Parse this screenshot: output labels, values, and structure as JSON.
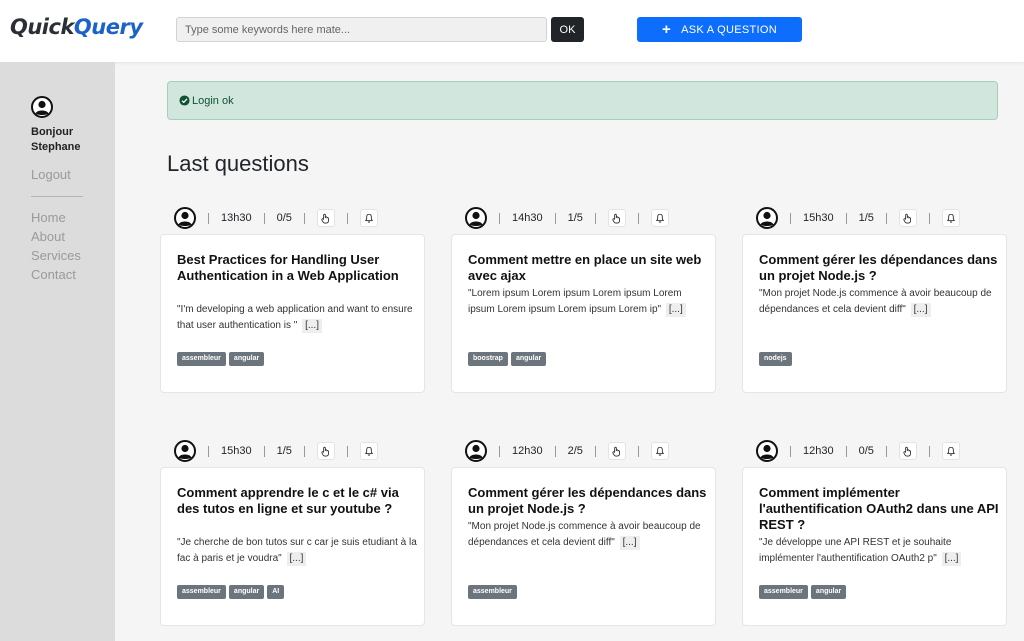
{
  "header": {
    "logo_part1": "Quick",
    "logo_part2": "Query",
    "search_placeholder": "Type some keywords here mate...",
    "ok_label": "OK",
    "ask_label": "ASK A QUESTION"
  },
  "sidebar": {
    "greeting_line1": "Bonjour",
    "greeting_line2": "Stephane",
    "logout": "Logout",
    "nav": [
      "Home",
      "About",
      "Services",
      "Contact"
    ]
  },
  "alert": {
    "text": "Login ok"
  },
  "section_title": "Last questions",
  "questions": [
    {
      "time": "13h30",
      "rating": "0/5",
      "title": "Best Practices for Handling User Authentication in a Web Application",
      "excerpt": "\"I'm developing a web application and want to ensure that user authentication is \"",
      "more": "[...]",
      "tags": [
        "assembleur",
        "angular"
      ]
    },
    {
      "time": "14h30",
      "rating": "1/5",
      "title": "Comment mettre en place un site web avec ajax",
      "excerpt": "\"Lorem ipsum Lorem ipsum Lorem ipsum Lorem ipsum Lorem ipsum Lorem ipsum Lorem ip\"",
      "more": "[...]",
      "tags": [
        "boostrap",
        "angular"
      ]
    },
    {
      "time": "15h30",
      "rating": "1/5",
      "title": "Comment gérer les dépendances dans un projet Node.js ?",
      "excerpt": "\"Mon projet Node.js commence à avoir beaucoup de dépendances et cela devient diff\"",
      "more": "[...]",
      "tags": [
        "nodejs"
      ]
    },
    {
      "time": "15h30",
      "rating": "1/5",
      "title": "Comment apprendre le c et le c# via des tutos en ligne et sur youtube ?",
      "excerpt": "\"Je cherche de bon tutos sur c car je suis etudiant à la fac à paris et je voudra\"",
      "more": "[...]",
      "tags": [
        "assembleur",
        "angular",
        "AI"
      ]
    },
    {
      "time": "12h30",
      "rating": "2/5",
      "title": "Comment gérer les dépendances dans un projet Node.js ?",
      "excerpt": "\"Mon projet Node.js commence à avoir beaucoup de dépendances et cela devient diff\"",
      "more": "[...]",
      "tags": [
        "assembleur"
      ]
    },
    {
      "time": "12h30",
      "rating": "0/5",
      "title": "Comment implémenter l'authentification OAuth2 dans une API REST ?",
      "excerpt": "\"Je développe une API REST et je souhaite implémenter l'authentification OAuth2 p\"",
      "more": "[...]",
      "tags": [
        "assembleur",
        "angular"
      ]
    }
  ],
  "icons": {
    "avatar": "user-circle-icon",
    "hand": "hand-pointer-icon",
    "bell": "bell-icon",
    "check": "check-circle-icon",
    "plus": "plus-icon"
  },
  "colors": {
    "brand_dark": "#2b2f36",
    "brand_blue": "#1b63c9",
    "primary": "#0d6efd",
    "alert_bg": "#d1e7dd",
    "tag_bg": "#6c757d",
    "sidebar_bg": "#dcdcdc"
  }
}
